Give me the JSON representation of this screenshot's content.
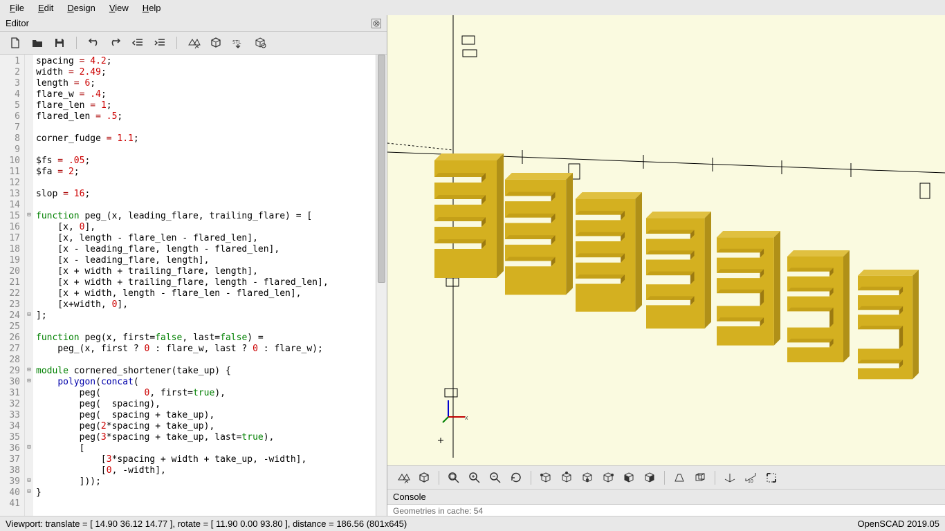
{
  "app_name": "OpenSCAD 2019.05",
  "menubar": {
    "file": "File",
    "edit": "Edit",
    "design": "Design",
    "view": "View",
    "help": "Help"
  },
  "editor": {
    "title": "Editor"
  },
  "code_lines": [
    {
      "n": 1,
      "tokens": [
        [
          "id",
          "spacing"
        ],
        [
          "op",
          " = "
        ],
        [
          "num",
          "4.2"
        ],
        [
          "id",
          ";"
        ]
      ]
    },
    {
      "n": 2,
      "tokens": [
        [
          "id",
          "width"
        ],
        [
          "op",
          " = "
        ],
        [
          "num",
          "2.49"
        ],
        [
          "id",
          ";"
        ]
      ]
    },
    {
      "n": 3,
      "tokens": [
        [
          "id",
          "length"
        ],
        [
          "op",
          " = "
        ],
        [
          "num",
          "6"
        ],
        [
          "id",
          ";"
        ]
      ]
    },
    {
      "n": 4,
      "tokens": [
        [
          "id",
          "flare_w"
        ],
        [
          "op",
          " = "
        ],
        [
          "num",
          ".4"
        ],
        [
          "id",
          ";"
        ]
      ]
    },
    {
      "n": 5,
      "tokens": [
        [
          "id",
          "flare_len"
        ],
        [
          "op",
          " = "
        ],
        [
          "num",
          "1"
        ],
        [
          "id",
          ";"
        ]
      ]
    },
    {
      "n": 6,
      "tokens": [
        [
          "id",
          "flared_len"
        ],
        [
          "op",
          " = "
        ],
        [
          "num",
          ".5"
        ],
        [
          "id",
          ";"
        ]
      ]
    },
    {
      "n": 7,
      "tokens": []
    },
    {
      "n": 8,
      "tokens": [
        [
          "id",
          "corner_fudge"
        ],
        [
          "op",
          " = "
        ],
        [
          "num",
          "1.1"
        ],
        [
          "id",
          ";"
        ]
      ]
    },
    {
      "n": 9,
      "tokens": []
    },
    {
      "n": 10,
      "tokens": [
        [
          "id",
          "$fs"
        ],
        [
          "op",
          " = "
        ],
        [
          "num",
          ".05"
        ],
        [
          "id",
          ";"
        ]
      ]
    },
    {
      "n": 11,
      "tokens": [
        [
          "id",
          "$fa"
        ],
        [
          "op",
          " = "
        ],
        [
          "num",
          "2"
        ],
        [
          "id",
          ";"
        ]
      ]
    },
    {
      "n": 12,
      "tokens": []
    },
    {
      "n": 13,
      "tokens": [
        [
          "id",
          "slop"
        ],
        [
          "op",
          " = "
        ],
        [
          "num",
          "16"
        ],
        [
          "id",
          ";"
        ]
      ]
    },
    {
      "n": 14,
      "tokens": []
    },
    {
      "n": 15,
      "fold": "-",
      "tokens": [
        [
          "kw",
          "function"
        ],
        [
          "id",
          " peg_(x, leading_flare, trailing_flare) = ["
        ]
      ]
    },
    {
      "n": 16,
      "tokens": [
        [
          "id",
          "    [x, "
        ],
        [
          "num",
          "0"
        ],
        [
          "id",
          "],"
        ]
      ]
    },
    {
      "n": 17,
      "tokens": [
        [
          "id",
          "    [x, length - flare_len - flared_len],"
        ]
      ]
    },
    {
      "n": 18,
      "tokens": [
        [
          "id",
          "    [x - leading_flare, length - flared_len],"
        ]
      ]
    },
    {
      "n": 19,
      "tokens": [
        [
          "id",
          "    [x - leading_flare, length],"
        ]
      ]
    },
    {
      "n": 20,
      "tokens": [
        [
          "id",
          "    [x + width + trailing_flare, length],"
        ]
      ]
    },
    {
      "n": 21,
      "tokens": [
        [
          "id",
          "    [x + width + trailing_flare, length - flared_len],"
        ]
      ]
    },
    {
      "n": 22,
      "tokens": [
        [
          "id",
          "    [x + width, length - flare_len - flared_len],"
        ]
      ]
    },
    {
      "n": 23,
      "tokens": [
        [
          "id",
          "    [x+width, "
        ],
        [
          "num",
          "0"
        ],
        [
          "id",
          "],"
        ]
      ]
    },
    {
      "n": 24,
      "fold": "-",
      "tokens": [
        [
          "id",
          "];"
        ]
      ]
    },
    {
      "n": 25,
      "tokens": []
    },
    {
      "n": 26,
      "tokens": [
        [
          "kw",
          "function"
        ],
        [
          "id",
          " peg(x, first="
        ],
        [
          "kw",
          "false"
        ],
        [
          "id",
          ", last="
        ],
        [
          "kw",
          "false"
        ],
        [
          "id",
          ") ="
        ]
      ]
    },
    {
      "n": 27,
      "tokens": [
        [
          "id",
          "    peg_(x, first ? "
        ],
        [
          "num",
          "0"
        ],
        [
          "id",
          " : flare_w, last ? "
        ],
        [
          "num",
          "0"
        ],
        [
          "id",
          " : flare_w);"
        ]
      ]
    },
    {
      "n": 28,
      "tokens": []
    },
    {
      "n": 29,
      "fold": "-",
      "tokens": [
        [
          "kw",
          "module"
        ],
        [
          "id",
          " cornered_shortener(take_up) {"
        ]
      ]
    },
    {
      "n": 30,
      "fold": "-",
      "tokens": [
        [
          "id",
          "    "
        ],
        [
          "blue",
          "polygon"
        ],
        [
          "id",
          "("
        ],
        [
          "blue",
          "concat"
        ],
        [
          "id",
          "("
        ]
      ]
    },
    {
      "n": 31,
      "tokens": [
        [
          "id",
          "        peg(        "
        ],
        [
          "num",
          "0"
        ],
        [
          "id",
          ", first="
        ],
        [
          "kw",
          "true"
        ],
        [
          "id",
          "),"
        ]
      ]
    },
    {
      "n": 32,
      "tokens": [
        [
          "id",
          "        peg(  spacing),"
        ]
      ]
    },
    {
      "n": 33,
      "tokens": [
        [
          "id",
          "        peg(  spacing + take_up),"
        ]
      ]
    },
    {
      "n": 34,
      "tokens": [
        [
          "id",
          "        peg("
        ],
        [
          "num",
          "2"
        ],
        [
          "id",
          "*spacing + take_up),"
        ]
      ]
    },
    {
      "n": 35,
      "tokens": [
        [
          "id",
          "        peg("
        ],
        [
          "num",
          "3"
        ],
        [
          "id",
          "*spacing + take_up, last="
        ],
        [
          "kw",
          "true"
        ],
        [
          "id",
          "),"
        ]
      ]
    },
    {
      "n": 36,
      "fold": "-",
      "tokens": [
        [
          "id",
          "        ["
        ]
      ]
    },
    {
      "n": 37,
      "tokens": [
        [
          "id",
          "            ["
        ],
        [
          "num",
          "3"
        ],
        [
          "id",
          "*spacing + width + take_up, -width],"
        ]
      ]
    },
    {
      "n": 38,
      "tokens": [
        [
          "id",
          "            ["
        ],
        [
          "num",
          "0"
        ],
        [
          "id",
          ", -width],"
        ]
      ]
    },
    {
      "n": 39,
      "fold": "-",
      "tokens": [
        [
          "id",
          "        ]));"
        ]
      ]
    },
    {
      "n": 40,
      "fold": "-",
      "tokens": [
        [
          "id",
          "}"
        ]
      ]
    },
    {
      "n": 41,
      "tokens": []
    }
  ],
  "console": {
    "title": "Console",
    "body": "Geometries in cache: 54"
  },
  "statusbar": {
    "left": "Viewport: translate = [ 14.90 36.12 14.77 ], rotate = [ 11.90 0.00 93.80 ], distance = 186.56 (801x645)",
    "right": "OpenSCAD 2019.05"
  },
  "toolbar_icons": [
    "new-file",
    "open-file",
    "save-file",
    "|",
    "undo",
    "redo",
    "unindent",
    "indent",
    "|",
    "preview",
    "render",
    "export-stl",
    "extras"
  ],
  "view_toolbar_icons": [
    "preview",
    "render",
    "|",
    "zoom-fit",
    "zoom-in",
    "zoom-out",
    "reset-view",
    "|",
    "view-right",
    "view-top",
    "view-bottom",
    "view-left",
    "view-front",
    "view-back",
    "|",
    "perspective",
    "orthographic",
    "|",
    "axes",
    "scale-marker",
    "view-all"
  ]
}
